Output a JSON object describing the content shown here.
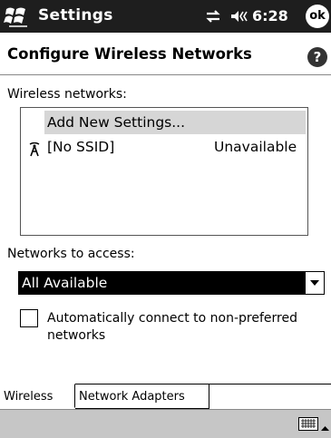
{
  "titlebar": {
    "app_title": "Settings",
    "time": "6:28",
    "ok_label": "ok",
    "icons": [
      "windows-start-icon",
      "connectivity-icon",
      "volume-icon"
    ]
  },
  "header": {
    "title": "Configure Wireless Networks",
    "help_label": "?"
  },
  "wireless_networks": {
    "label": "Wireless networks:",
    "items": [
      {
        "name": "Add New Settings...",
        "status": "",
        "selected": true
      },
      {
        "name": "[No SSID]",
        "status": "Unavailable",
        "icon": "antenna-icon"
      }
    ]
  },
  "networks_to_access": {
    "label": "Networks to access:",
    "selected": "All Available"
  },
  "auto_connect": {
    "label": "Automatically connect to non-preferred networks",
    "checked": false
  },
  "tabs": [
    {
      "label": "Wireless",
      "active": true
    },
    {
      "label": "Network Adapters",
      "active": false
    }
  ],
  "bottombar": {
    "icons": [
      "keyboard-icon",
      "sip-up-arrow-icon"
    ]
  },
  "colors": {
    "titlebar_bg": "#1e1e1e",
    "selection_bg": "#000000",
    "highlight_row": "#d6d6d6",
    "bottombar_bg": "#c6c6c6"
  }
}
